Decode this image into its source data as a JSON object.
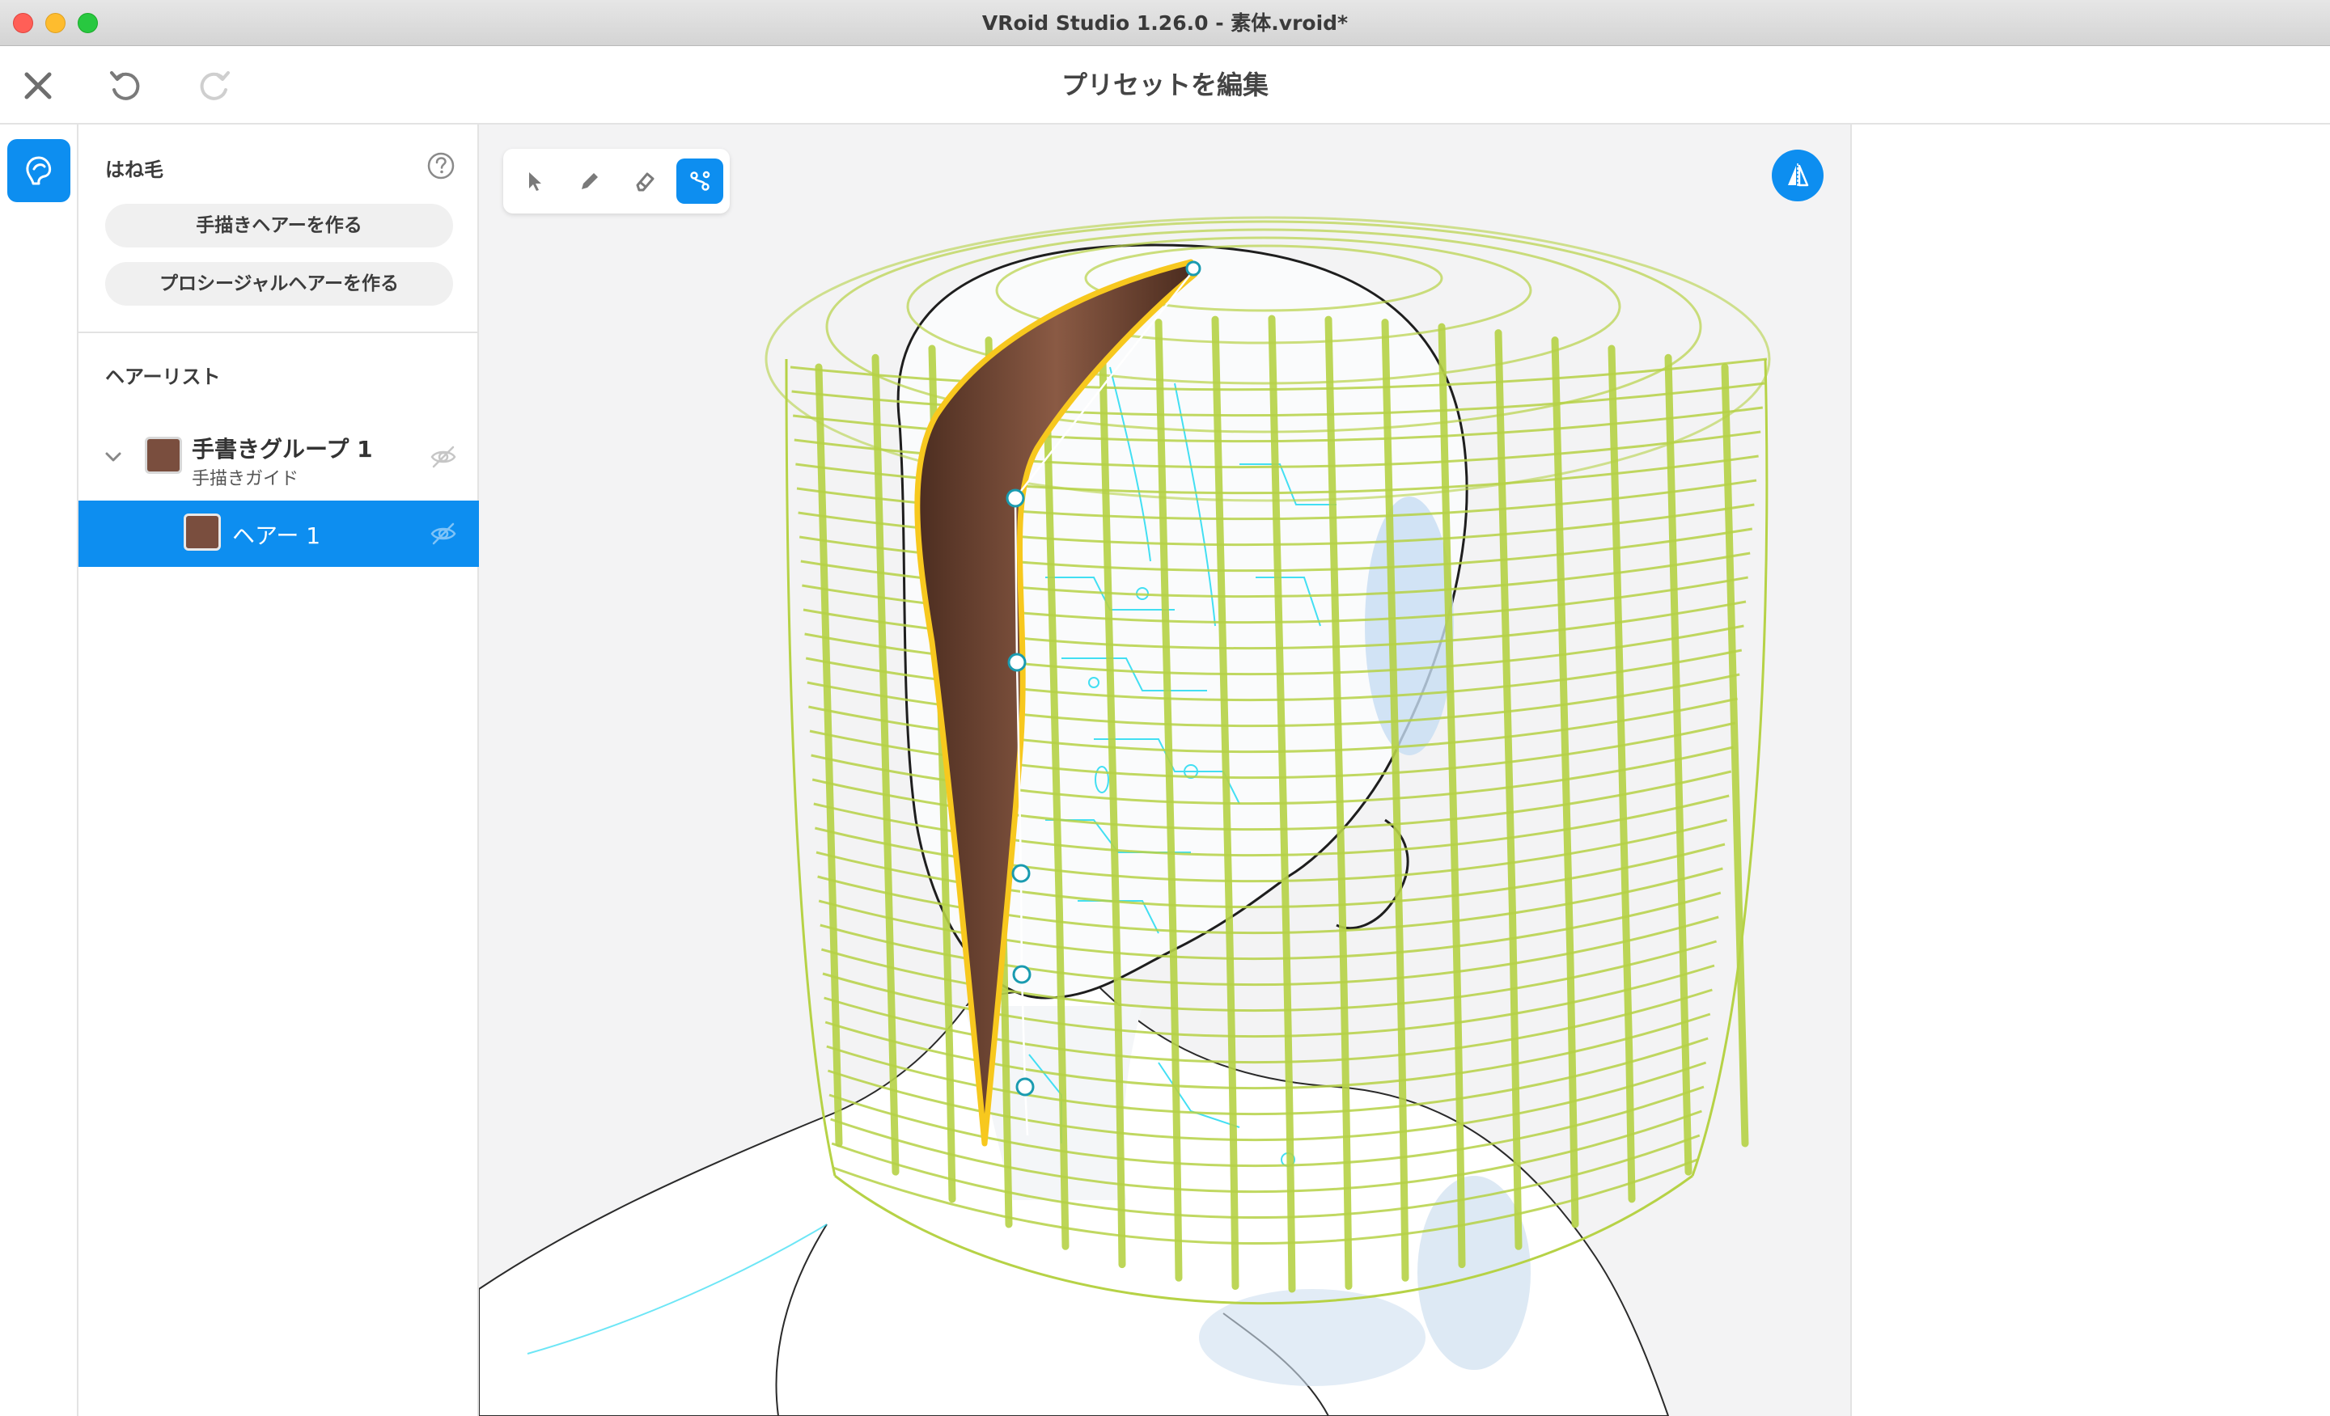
{
  "window": {
    "title": "VRoid Studio 1.26.0 - 素体.vroid*"
  },
  "header": {
    "title": "プリセットを編集"
  },
  "panel": {
    "section_title": "はね毛",
    "create_hand_drawn": "手描きヘアーを作る",
    "create_procedural": "プロシージャルヘアーを作る",
    "hair_list_title": "ヘアーリスト",
    "group": {
      "name": "手書きグループ 1",
      "subtitle": "手描きガイド",
      "color": "#7a4e3e"
    },
    "item": {
      "name": "ヘアー 1",
      "color": "#7a4e3e"
    }
  },
  "colors": {
    "accent": "#0d8ef0",
    "hair": "#6b4331",
    "hair_outline": "#f7c81e",
    "guide_mesh": "#b6d246",
    "body_lines": "#2fdcf2"
  },
  "icons": {
    "close": "close-icon",
    "undo": "undo-icon",
    "redo": "redo-icon",
    "rail": "hair-tool-icon",
    "help": "help-icon",
    "tools": [
      "select-arrow-icon",
      "pencil-icon",
      "eraser-icon",
      "control-point-icon"
    ],
    "symmetry": "symmetry-icon"
  }
}
